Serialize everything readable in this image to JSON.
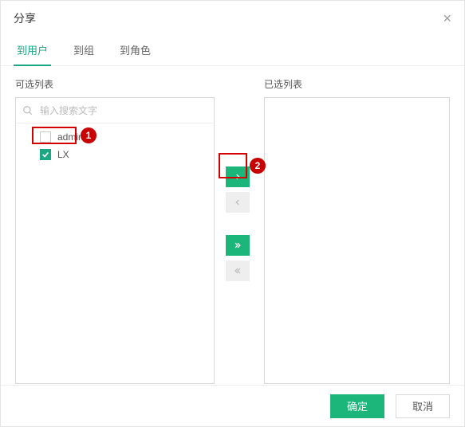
{
  "dialog": {
    "title": "分享"
  },
  "tabs": [
    {
      "label": "到用户",
      "active": true
    },
    {
      "label": "到组",
      "active": false
    },
    {
      "label": "到角色",
      "active": false
    }
  ],
  "left": {
    "label": "可选列表",
    "search_placeholder": "输入搜索文字",
    "items": [
      {
        "label": "admin",
        "checked": false
      },
      {
        "label": "LX",
        "checked": true
      }
    ]
  },
  "right": {
    "label": "已选列表"
  },
  "transfer": {
    "add": "›",
    "remove": "‹",
    "add_all": "»",
    "remove_all": "«"
  },
  "footer": {
    "ok": "确定",
    "cancel": "取消"
  },
  "annotations": {
    "1": "1",
    "2": "2"
  }
}
